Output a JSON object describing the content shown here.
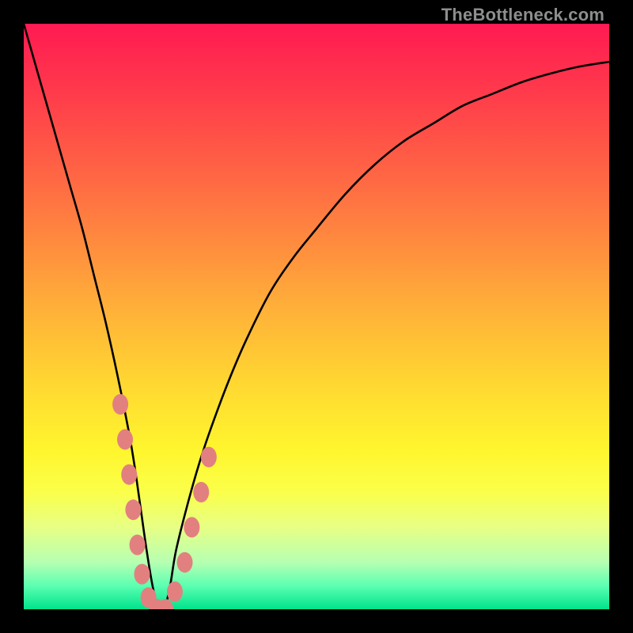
{
  "watermark": "TheBottleneck.com",
  "chart_data": {
    "type": "line",
    "title": "",
    "xlabel": "",
    "ylabel": "",
    "xlim": [
      0,
      100
    ],
    "ylim": [
      0,
      100
    ],
    "grid": false,
    "legend": false,
    "annotations": [],
    "gradient_stops": [
      {
        "pos": 0.0,
        "color": "#ff1a52"
      },
      {
        "pos": 0.12,
        "color": "#ff3b4b"
      },
      {
        "pos": 0.3,
        "color": "#ff7342"
      },
      {
        "pos": 0.48,
        "color": "#ffae39"
      },
      {
        "pos": 0.62,
        "color": "#ffd931"
      },
      {
        "pos": 0.73,
        "color": "#fff62e"
      },
      {
        "pos": 0.8,
        "color": "#fbff4a"
      },
      {
        "pos": 0.86,
        "color": "#e7ff85"
      },
      {
        "pos": 0.92,
        "color": "#b6ffb2"
      },
      {
        "pos": 0.96,
        "color": "#5bffb1"
      },
      {
        "pos": 1.0,
        "color": "#00e38c"
      }
    ],
    "series": [
      {
        "name": "bottleneck-curve",
        "stroke": "#000000",
        "x": [
          0,
          2,
          4,
          6,
          8,
          10,
          12,
          14,
          16,
          18,
          19,
          20,
          21,
          22,
          23,
          24,
          25,
          26,
          28,
          30,
          32,
          35,
          38,
          42,
          46,
          50,
          55,
          60,
          65,
          70,
          75,
          80,
          85,
          90,
          95,
          100
        ],
        "y": [
          100,
          93,
          86,
          79,
          72,
          65,
          57,
          49,
          40,
          30,
          24,
          17,
          10,
          4,
          0,
          0,
          4,
          10,
          18,
          25,
          31,
          39,
          46,
          54,
          60,
          65,
          71,
          76,
          80,
          83,
          86,
          88,
          90,
          91.5,
          92.7,
          93.5
        ]
      }
    ],
    "markers": {
      "name": "highlight-dots",
      "fill": "#e28080",
      "points": [
        {
          "x": 16.5,
          "y": 35
        },
        {
          "x": 17.3,
          "y": 29
        },
        {
          "x": 18.0,
          "y": 23
        },
        {
          "x": 18.7,
          "y": 17
        },
        {
          "x": 19.4,
          "y": 11
        },
        {
          "x": 20.2,
          "y": 6
        },
        {
          "x": 21.3,
          "y": 2
        },
        {
          "x": 22.7,
          "y": 0
        },
        {
          "x": 24.2,
          "y": 0
        },
        {
          "x": 25.8,
          "y": 3
        },
        {
          "x": 27.5,
          "y": 8
        },
        {
          "x": 28.7,
          "y": 14
        },
        {
          "x": 30.3,
          "y": 20
        },
        {
          "x": 31.6,
          "y": 26
        }
      ]
    }
  }
}
